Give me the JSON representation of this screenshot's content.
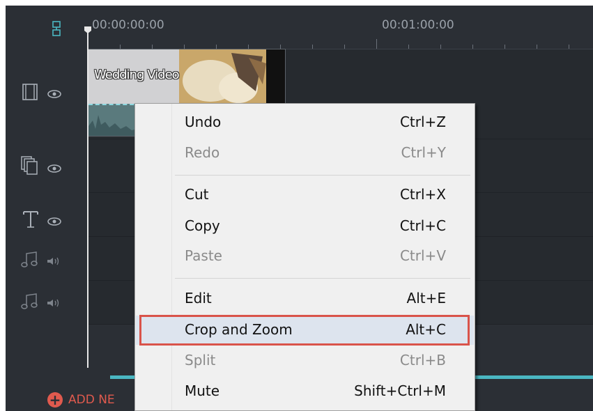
{
  "timeline": {
    "timecodes": [
      "00:00:00:00",
      "00:01:00:00"
    ],
    "clip": {
      "title": "Wedding Video"
    },
    "add_track_label": "ADD NE"
  },
  "tracks": [
    {
      "type": "video",
      "icons": [
        "film-icon",
        "eye-icon"
      ]
    },
    {
      "type": "overlay",
      "icons": [
        "layers-icon",
        "eye-icon"
      ]
    },
    {
      "type": "text",
      "icons": [
        "text-icon",
        "eye-icon"
      ]
    },
    {
      "type": "music",
      "icons": [
        "music-note-icon",
        "speaker-icon"
      ]
    },
    {
      "type": "music",
      "icons": [
        "music-note-icon",
        "speaker-icon"
      ]
    }
  ],
  "context_menu": {
    "items": [
      {
        "label": "Undo",
        "shortcut": "Ctrl+Z",
        "enabled": true
      },
      {
        "label": "Redo",
        "shortcut": "Ctrl+Y",
        "enabled": false
      },
      {
        "label": "Cut",
        "shortcut": "Ctrl+X",
        "enabled": true
      },
      {
        "label": "Copy",
        "shortcut": "Ctrl+C",
        "enabled": true
      },
      {
        "label": "Paste",
        "shortcut": "Ctrl+V",
        "enabled": false
      },
      {
        "label": "Edit",
        "shortcut": "Alt+E",
        "enabled": true
      },
      {
        "label": "Crop and Zoom",
        "shortcut": "Alt+C",
        "enabled": true,
        "highlighted": true
      },
      {
        "label": "Split",
        "shortcut": "Ctrl+B",
        "enabled": false
      },
      {
        "label": "Mute",
        "shortcut": "Shift+Ctrl+M",
        "enabled": true
      }
    ]
  },
  "colors": {
    "highlight_box": "#d9534a",
    "accent": "#4ab7c2",
    "add_button": "#e05a4e"
  }
}
